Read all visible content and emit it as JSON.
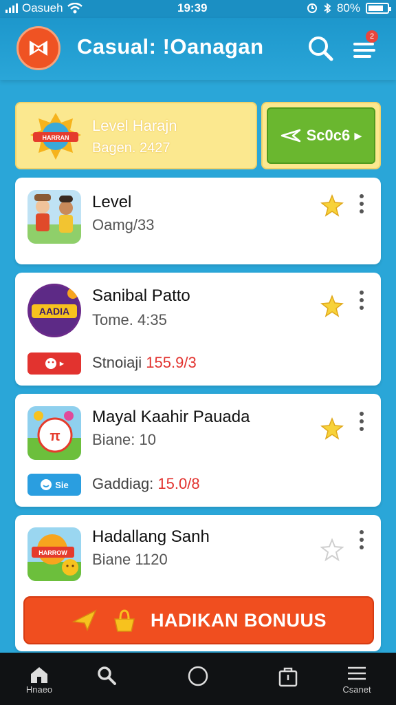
{
  "status_bar": {
    "carrier": "Oasueh",
    "time": "19:39",
    "battery": "80%",
    "battery_level": 0.8
  },
  "header": {
    "title": "Casual: !Oanagan",
    "notification_count": "2"
  },
  "banner": {
    "title": "Level Harajn",
    "subtitle": "Bagen. 2427",
    "badge_text": "HARRAN",
    "button_label": "Sc0c6 ▸"
  },
  "cards": [
    {
      "title": "Level",
      "subtitle": "Oamg/33",
      "starred": true,
      "thumb_text": ""
    },
    {
      "title": "Sanibal Patto",
      "subtitle": "Tome. 4:35",
      "starred": true,
      "thumb_text": "AADIA",
      "stat_label": "Stnoiaji ",
      "stat_value": "155.9/3",
      "badge_text": "▸"
    },
    {
      "title": "Mayal Kaahir Pauada",
      "subtitle": "Biane: 10",
      "starred": true,
      "thumb_text": "",
      "stat_label": "Gaddiag: ",
      "stat_value": "15.0/8",
      "badge_text": "Sie"
    },
    {
      "title": "Hadallang Sanh",
      "subtitle": "Biane 1120",
      "starred": false,
      "thumb_text": "HARROW"
    }
  ],
  "bonus_button": {
    "label": "HADIKAN BONUUS"
  },
  "bottom_nav": [
    {
      "label": "Hnaeo",
      "icon": "home-icon"
    },
    {
      "label": "",
      "icon": "search-icon"
    },
    {
      "label": "",
      "icon": "circle-icon"
    },
    {
      "label": "",
      "icon": "bag-icon"
    },
    {
      "label": "Csanet",
      "icon": "menu-icon"
    }
  ],
  "colors": {
    "background": "#2aa6d8",
    "accent_orange": "#f04e1f",
    "accent_green": "#6ab72f",
    "star_yellow": "#f7c21e",
    "value_red": "#e2332f"
  }
}
